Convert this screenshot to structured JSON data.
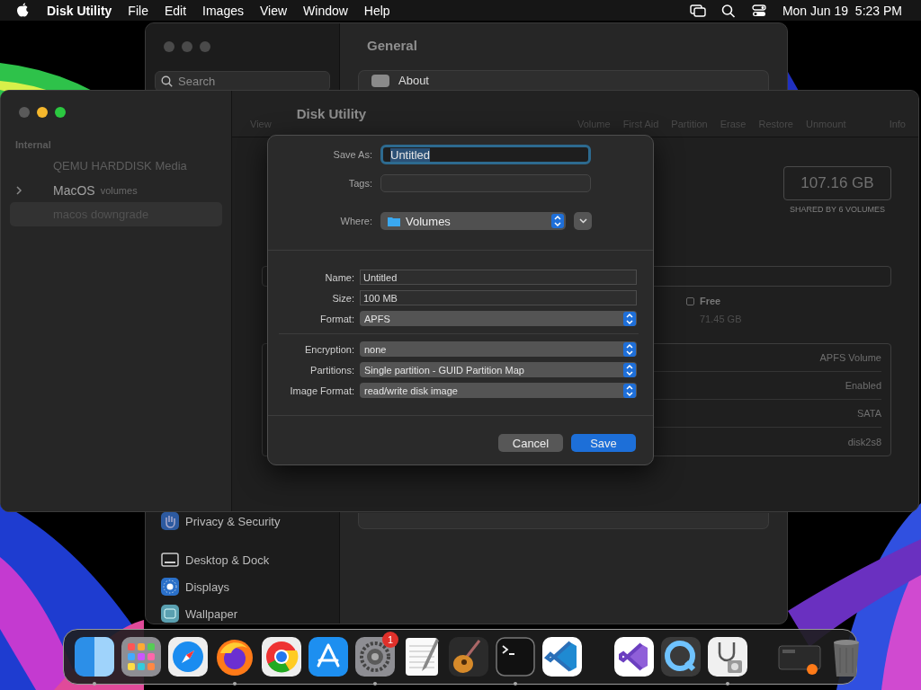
{
  "menu_bar": {
    "app": "Disk Utility",
    "menus": [
      "File",
      "Edit",
      "Images",
      "View",
      "Window",
      "Help"
    ],
    "clock": "Mon Jun 19  5:23 PM"
  },
  "settings_window": {
    "search": {
      "placeholder": "Search"
    },
    "title": "General",
    "rows": [
      {
        "label": "About"
      }
    ],
    "sidebar": [
      {
        "label": "Privacy & Security",
        "kind": "privacy"
      },
      {
        "label": "Desktop & Dock",
        "kind": "dock"
      },
      {
        "label": "Displays",
        "kind": "displays"
      },
      {
        "label": "Wallpaper",
        "kind": "wallpaper"
      }
    ]
  },
  "disk_utility": {
    "title": "Disk Utility",
    "view_label": "View",
    "toolbar": [
      "Volume",
      "First Aid",
      "Partition",
      "Erase",
      "Restore",
      "Unmount",
      "Info"
    ],
    "sidebar": {
      "section": "Internal",
      "items": [
        {
          "label": "QEMU HARDDISK Media",
          "kind": "disk",
          "selected": false
        },
        {
          "label": "MacOS",
          "sublabel": "volumes",
          "kind": "container",
          "selected": false
        },
        {
          "label": "macos downgrade",
          "kind": "volume",
          "selected": true
        }
      ]
    },
    "capacity": "107.16 GB",
    "capacity_note": "SHARED BY 6 VOLUMES",
    "legend": [
      {
        "label": "Free",
        "value": "71.45 GB"
      }
    ],
    "info_values": [
      "APFS Volume",
      "Enabled",
      "SATA",
      "disk2s8"
    ]
  },
  "save_dialog": {
    "save_as": {
      "label": "Save As:",
      "value": "Untitled",
      "selected": true
    },
    "tags": {
      "label": "Tags:"
    },
    "where": {
      "label": "Where:",
      "value": "Volumes"
    },
    "groups": [
      [
        {
          "label": "Name:",
          "value": "Untitled",
          "kind": "text"
        },
        {
          "label": "Size:",
          "value": "100 MB",
          "kind": "text"
        },
        {
          "label": "Format:",
          "value": "APFS",
          "kind": "popup"
        }
      ],
      [
        {
          "label": "Encryption:",
          "value": "none",
          "kind": "popup"
        },
        {
          "label": "Partitions:",
          "value": "Single partition - GUID Partition Map",
          "kind": "popup"
        },
        {
          "label": "Image Format:",
          "value": "read/write disk image",
          "kind": "popup"
        }
      ]
    ],
    "buttons": [
      {
        "label": "Cancel",
        "primary": false
      },
      {
        "label": "Save",
        "primary": true
      }
    ]
  },
  "dock": [
    {
      "kind": "finder",
      "running": true
    },
    {
      "kind": "launchpad",
      "running": false
    },
    {
      "kind": "safari",
      "running": false
    },
    {
      "kind": "firefox",
      "running": true
    },
    {
      "kind": "chrome",
      "running": false
    },
    {
      "kind": "appstore",
      "running": false
    },
    {
      "kind": "settings",
      "running": true,
      "badge": "1"
    },
    {
      "kind": "textedit",
      "running": false
    },
    {
      "kind": "guitar",
      "running": false
    },
    {
      "kind": "terminal",
      "running": true
    },
    {
      "kind": "code",
      "running": false
    },
    {
      "kind": "separator"
    },
    {
      "kind": "studio",
      "running": false
    },
    {
      "kind": "quicktime",
      "running": false
    },
    {
      "kind": "diskutility",
      "running": true
    },
    {
      "kind": "separator"
    },
    {
      "kind": "thumbnail",
      "running": false
    },
    {
      "kind": "trash",
      "running": false
    }
  ]
}
